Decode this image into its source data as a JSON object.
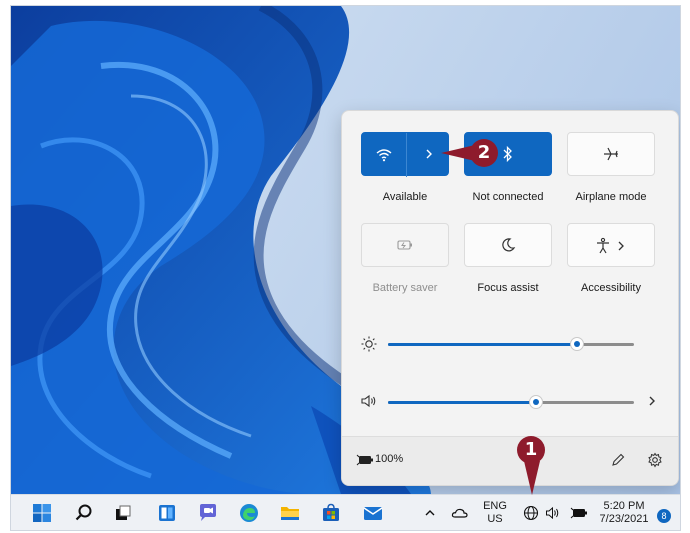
{
  "quick_settings": {
    "tiles": [
      {
        "label": "Available",
        "icon": "wifi-icon",
        "active": true,
        "expandable": true
      },
      {
        "label": "Not connected",
        "icon": "bluetooth-icon",
        "active": true,
        "expandable": false
      },
      {
        "label": "Airplane mode",
        "icon": "airplane-icon",
        "active": false,
        "expandable": false
      },
      {
        "label": "Battery saver",
        "icon": "battery-saver-icon",
        "active": false,
        "disabled": true
      },
      {
        "label": "Focus assist",
        "icon": "moon-icon",
        "active": false
      },
      {
        "label": "Accessibility",
        "icon": "accessibility-icon",
        "active": false,
        "expandable": true
      }
    ],
    "brightness_level": 0.77,
    "volume_level": 0.6,
    "battery_text": "100%"
  },
  "taskbar": {
    "apps": [
      "start-icon",
      "search-icon",
      "task-view-icon",
      "widgets-icon",
      "chat-icon",
      "edge-icon",
      "file-explorer-icon",
      "store-icon",
      "mail-icon"
    ],
    "language_line1": "ENG",
    "language_line2": "US",
    "time": "5:20 PM",
    "date": "7/23/2021",
    "notification_count": "8"
  },
  "callouts": {
    "one": "1",
    "two": "2"
  },
  "colors": {
    "accent": "#0f67c0",
    "callout": "#8e1b2c"
  }
}
